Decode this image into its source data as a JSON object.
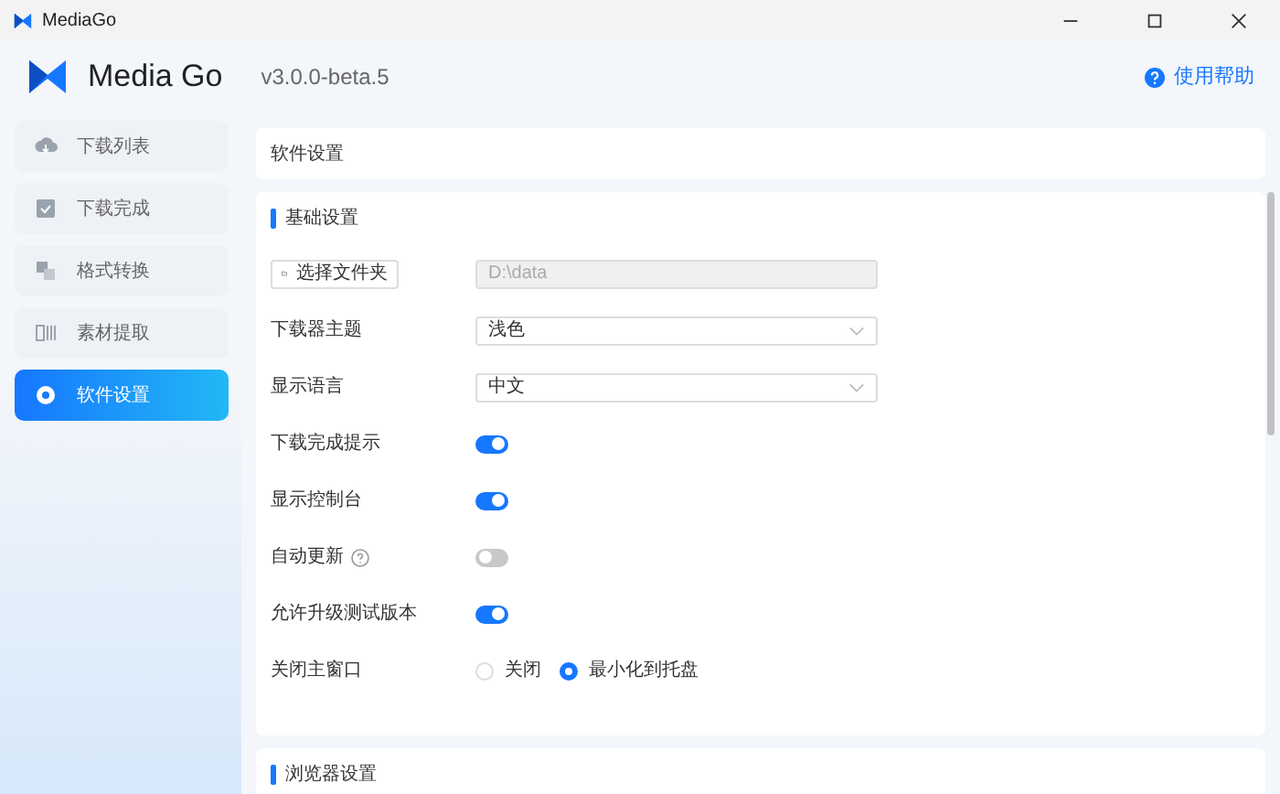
{
  "window": {
    "title": "MediaGo"
  },
  "header": {
    "app_name": "Media Go",
    "version": "v3.0.0-beta.5",
    "help_link": "使用帮助"
  },
  "sidebar": {
    "items": [
      {
        "label": "下载列表",
        "selected": false
      },
      {
        "label": "下载完成",
        "selected": false
      },
      {
        "label": "格式转换",
        "selected": false
      },
      {
        "label": "素材提取",
        "selected": false
      },
      {
        "label": "软件设置",
        "selected": true
      }
    ]
  },
  "page_title": "软件设置",
  "sections": [
    {
      "title": "基础设置",
      "settings": [
        {
          "kind": "folder",
          "button": "选择文件夹",
          "value": "D:\\data"
        },
        {
          "kind": "select",
          "label": "下载器主题",
          "value": "浅色"
        },
        {
          "kind": "select",
          "label": "显示语言",
          "value": "中文"
        },
        {
          "kind": "toggle",
          "label": "下载完成提示",
          "on": true
        },
        {
          "kind": "toggle",
          "label": "显示控制台",
          "on": true
        },
        {
          "kind": "toggle",
          "label": "自动更新",
          "on": false,
          "help": true
        },
        {
          "kind": "toggle",
          "label": "允许升级测试版本",
          "on": true
        },
        {
          "kind": "radio",
          "label": "关闭主窗口",
          "options": [
            {
              "label": "关闭",
              "selected": false
            },
            {
              "label": "最小化到托盘",
              "selected": true
            }
          ]
        }
      ]
    },
    {
      "title": "浏览器设置"
    }
  ]
}
